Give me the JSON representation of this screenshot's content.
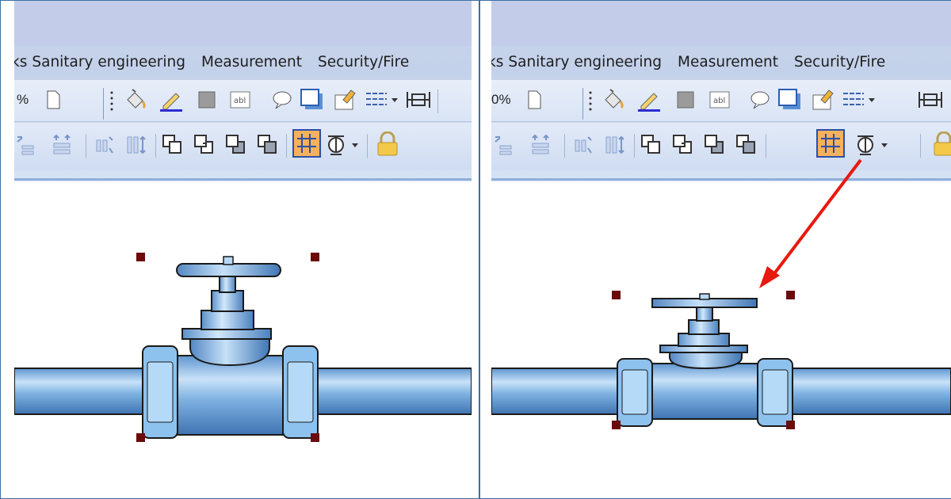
{
  "left_panel": {
    "tabs": [
      "ks",
      "Sanitary engineering",
      "Measurement",
      "Security/Fire"
    ],
    "zoom_text": "%",
    "tools_row1": [
      "page-icon",
      "fill-icon",
      "pencil-icon",
      "color-square-icon",
      "text-box-icon",
      "callout-icon",
      "shadow-icon",
      "properties-icon",
      "line-style-icon",
      "frame-icon"
    ],
    "tools_row2": [
      "align-icon",
      "align-icon",
      "distribute-icon",
      "distribute-icon",
      "bring-forward-icon",
      "send-backward-icon",
      "bring-to-front-icon",
      "send-to-back-icon",
      "grid-icon",
      "snap-icon",
      "lock-icon"
    ]
  },
  "right_panel": {
    "tabs": [
      "ks",
      "Sanitary engineering",
      "Measurement",
      "Security/Fire"
    ],
    "zoom_text": "0%",
    "tools_row1": [
      "page-icon",
      "fill-icon",
      "pencil-icon",
      "color-square-icon",
      "text-box-icon",
      "callout-icon",
      "shadow-icon",
      "properties-icon",
      "line-style-icon",
      "frame-icon"
    ],
    "tools_row2": [
      "align-icon",
      "align-icon",
      "distribute-icon",
      "distribute-icon",
      "bring-forward-icon",
      "send-backward-icon",
      "bring-to-front-icon",
      "send-to-back-icon",
      "grid-icon",
      "snap-icon",
      "lock-icon"
    ]
  },
  "colors": {
    "ribbon": "#c3cce8",
    "pipe": "#7fb2e2",
    "handle": "#6b0b0b",
    "arrow": "#e8190f",
    "grid_active": "#f6b15c"
  }
}
